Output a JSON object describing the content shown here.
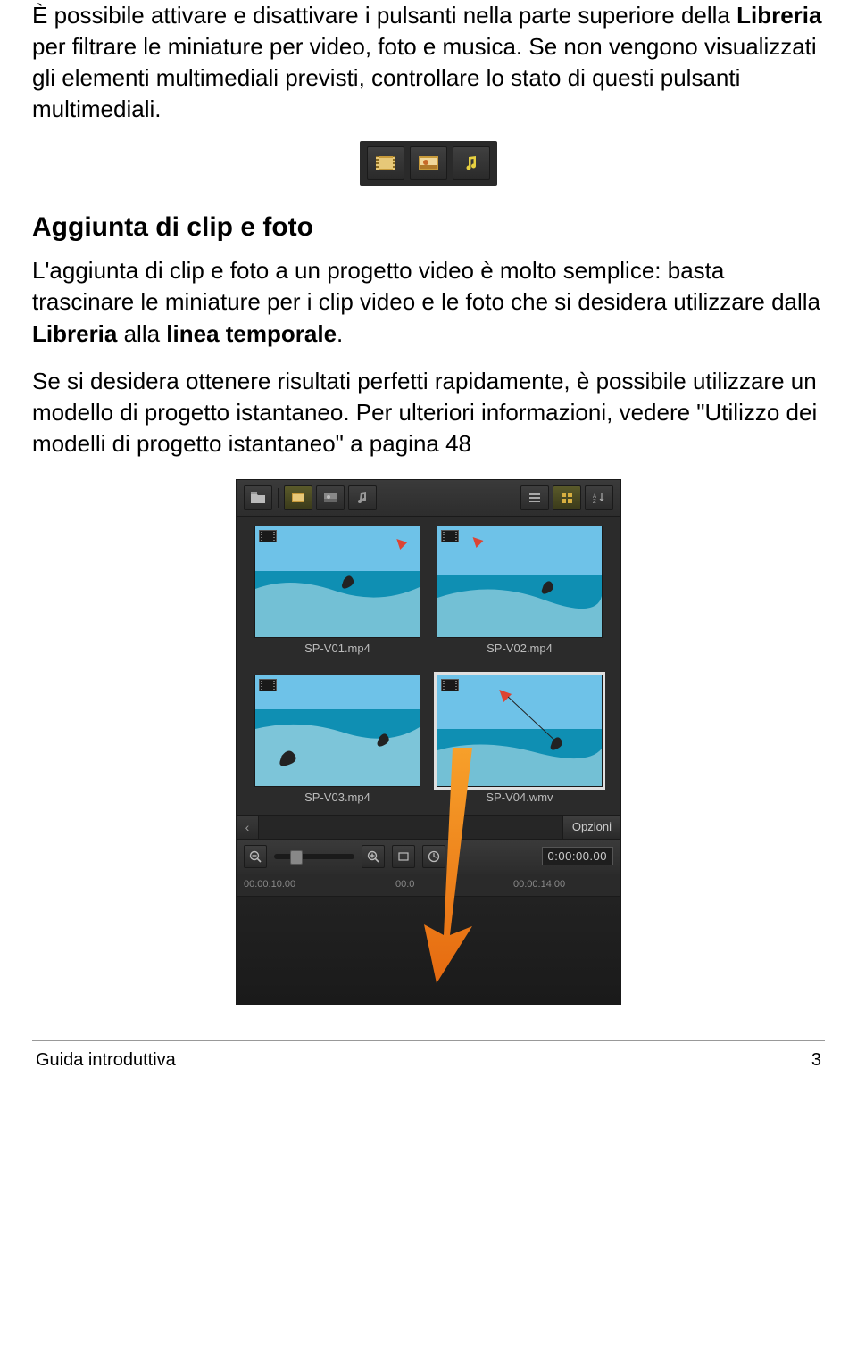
{
  "paragraphs": {
    "p1a": "È possibile attivare e disattivare i pulsanti nella parte superiore della ",
    "p1b": "Libreria",
    "p1c": " per filtrare le miniature per video, foto e musica. Se non vengono visualizzati gli elementi multimediali previsti, controllare lo stato di questi pulsanti multimediali.",
    "h1": "Aggiunta di clip e foto",
    "p2a": "L'aggiunta di clip e foto a un progetto video è molto semplice: basta trascinare le miniature per i clip video e le foto che si desidera utilizzare dalla ",
    "p2b": "Libreria",
    "p2c": " alla ",
    "p2d": "linea temporale",
    "p2e": ".",
    "p3": "Se si desidera ottenere risultati perfetti rapidamente, è possibile utilizzare un modello di progetto istantaneo. Per ulteriori informazioni, vedere \"Utilizzo dei modelli di progetto istantaneo\" a pagina 48"
  },
  "filterButtons": {
    "video": "video-filter",
    "photo": "photo-filter",
    "audio": "audio-filter"
  },
  "library": {
    "thumbs": [
      {
        "label": "SP-V01.mp4",
        "selected": false
      },
      {
        "label": "SP-V02.mp4",
        "selected": false
      },
      {
        "label": "SP-V03.mp4",
        "selected": false
      },
      {
        "label": "SP-V04.wmv",
        "selected": true
      }
    ],
    "optionsLabel": "Opzioni"
  },
  "timeline": {
    "timecode": "0:00:00.00",
    "ruler": {
      "t1": "00:00:10.00",
      "t2": "00:0",
      "t3": "00:00:14.00"
    }
  },
  "footer": {
    "left": "Guida introduttiva",
    "right": "3"
  }
}
